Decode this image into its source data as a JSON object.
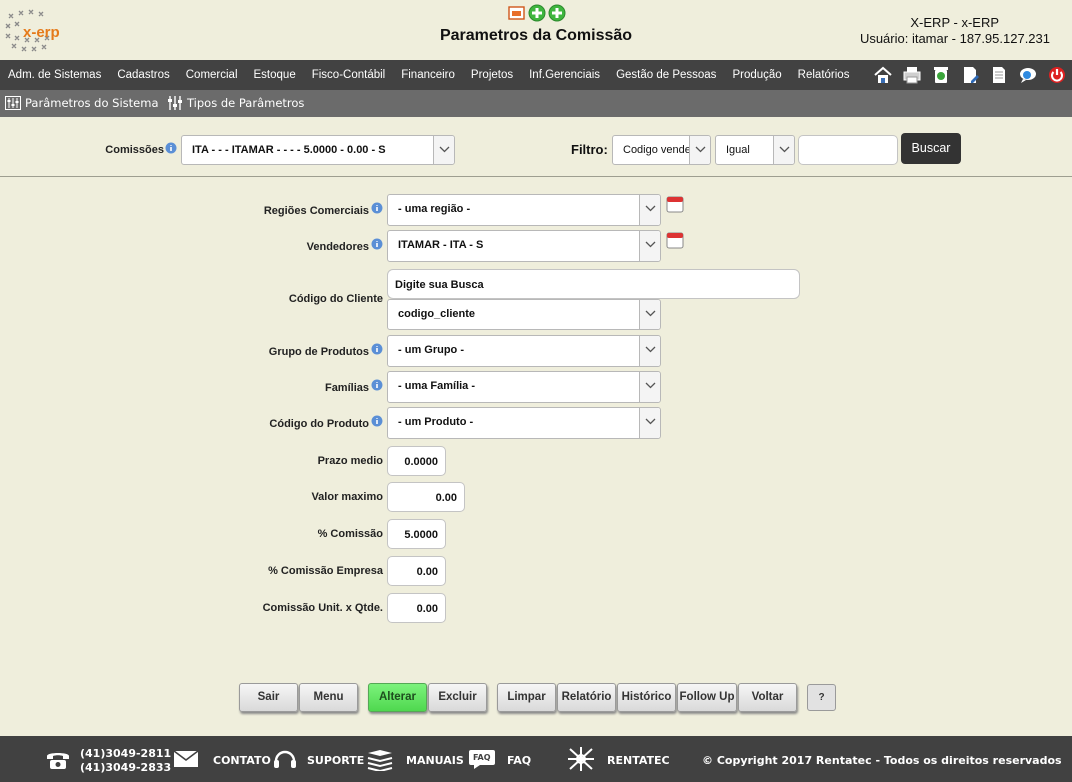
{
  "header": {
    "logo_text": "x-erp",
    "title": "Parametros da Comissão",
    "system": "X-ERP - x-ERP",
    "user": "Usuário: itamar - 187.95.127.231"
  },
  "menu": [
    "Adm. de Sistemas",
    "Cadastros",
    "Comercial",
    "Estoque",
    "Fisco-Contábil",
    "Financeiro",
    "Projetos",
    "Inf.Gerenciais",
    "Gestão de Pessoas",
    "Produção",
    "Relatórios"
  ],
  "toolbar_icons": [
    "home-icon",
    "print-icon",
    "trash-icon",
    "document-edit-icon",
    "document-icon",
    "chat-icon",
    "power-icon"
  ],
  "subbar": {
    "system_params": "Parâmetros do Sistema",
    "param_types": "Tipos de Parâmetros"
  },
  "top": {
    "commissions_label": "Comissões",
    "commissions_value": "ITA - - - ITAMAR - - - - 5.0000 - 0.00 - S",
    "filter_label": "Filtro:",
    "filter_field": "Codigo vendedor",
    "filter_op": "Igual",
    "filter_value": "",
    "search_button": "Buscar"
  },
  "form": {
    "regions_label": "Regiões Comerciais",
    "regions_value": "- uma região -",
    "sellers_label": "Vendedores",
    "sellers_value": "ITAMAR - ITA - S",
    "client_label": "Código do Cliente",
    "client_search_placeholder": "Digite sua Busca",
    "client_field": "codigo_cliente",
    "group_label": "Grupo de Produtos",
    "group_value": "- um Grupo -",
    "family_label": "Famílias",
    "family_value": "- uma Família -",
    "product_label": "Código do Produto",
    "product_value": "- um Produto -",
    "term_label": "Prazo medio",
    "term_value": "0.0000",
    "max_label": "Valor maximo",
    "max_value": "0.00",
    "commission_label": "% Comissão",
    "commission_value": "5.0000",
    "company_commission_label": "% Comissão Empresa",
    "company_commission_value": "0.00",
    "unit_commission_label": "Comissão Unit. x Qtde.",
    "unit_commission_value": "0.00"
  },
  "buttons": {
    "exit": "Sair",
    "menu": "Menu",
    "update": "Alterar",
    "delete": "Excluir",
    "clear": "Limpar",
    "report": "Relatório",
    "history": "Histórico",
    "followup": "Follow Up",
    "back": "Voltar",
    "help": "?"
  },
  "footer": {
    "phone1": "(41)3049-2811",
    "phone2": "(41)3049-2833",
    "contact": "CONTATO",
    "support": "SUPORTE",
    "manuals": "MANUAIS",
    "faq_icon_text": "FAQ",
    "faq": "FAQ",
    "company": "RENTATEC",
    "copyright": "© Copyright 2017 Rentatec - Todos os direitos reservados"
  },
  "colors": {
    "background": "#efeedc",
    "menubar": "#424242",
    "subbar": "#6b6b6b",
    "footer": "#414141",
    "green_button": "#5ee05e",
    "logo_orange": "#e57a1a"
  }
}
